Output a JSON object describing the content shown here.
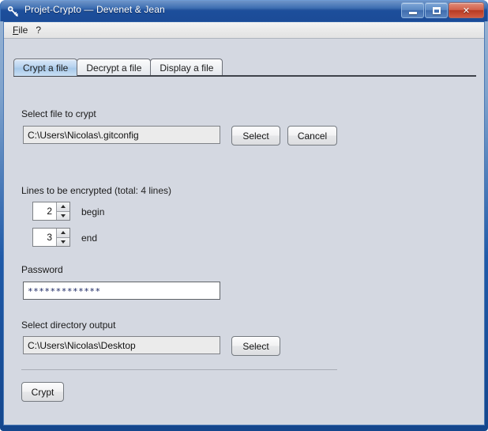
{
  "window": {
    "title": "Projet-Crypto — Devenet & Jean",
    "icon": "key-icon",
    "controls": {
      "minimize": "minimize-icon",
      "maximize": "maximize-icon",
      "close": "✕"
    },
    "frame_color": "#1b4b97",
    "client_background": "#d4d8e1"
  },
  "menubar": {
    "items": [
      {
        "label": "File",
        "mnemonic": "F"
      },
      {
        "label": "?",
        "mnemonic": ""
      }
    ]
  },
  "tabs": [
    {
      "label": "Crypt a file",
      "selected": true
    },
    {
      "label": "Decrypt a file",
      "selected": false
    },
    {
      "label": "Display a file",
      "selected": false
    }
  ],
  "form": {
    "file_section": {
      "label": "Select file to crypt",
      "value": "C:\\Users\\Nicolas\\.gitconfig",
      "placeholder": "",
      "select_button": "Select",
      "cancel_button": "Cancel"
    },
    "lines_section": {
      "label": "Lines to be encrypted",
      "total_text": "(total: 4 lines)",
      "begin": {
        "value": "2",
        "label": "begin"
      },
      "end": {
        "value": "3",
        "label": "end"
      }
    },
    "password_section": {
      "label": "Password",
      "value": "*************",
      "placeholder": ""
    },
    "output_section": {
      "label": "Select directory output",
      "value": "C:\\Users\\Nicolas\\Desktop",
      "placeholder": "",
      "select_button": "Select"
    },
    "submit_button": "Crypt"
  }
}
